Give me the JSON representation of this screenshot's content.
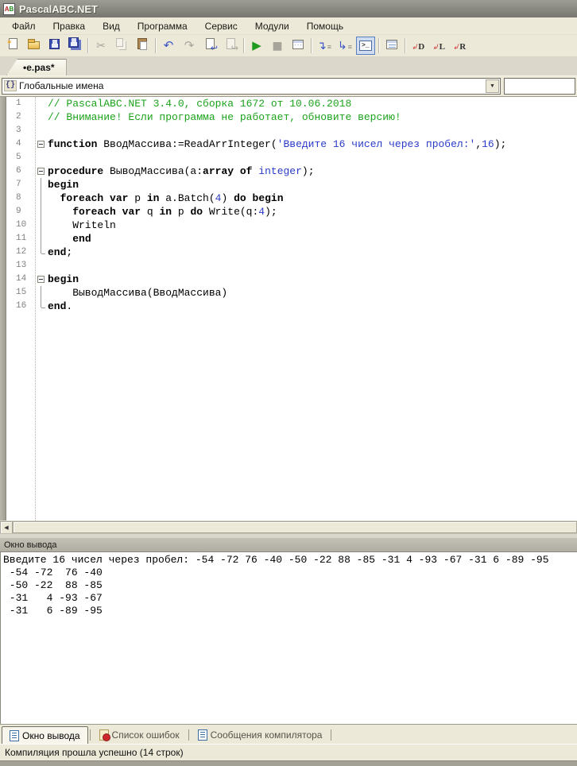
{
  "window": {
    "title": "PascalABC.NET"
  },
  "menu": {
    "items": [
      "Файл",
      "Правка",
      "Вид",
      "Программа",
      "Сервис",
      "Модули",
      "Помощь"
    ]
  },
  "toolbar": {
    "groups": [
      {
        "buttons": [
          {
            "icon": "new-file-icon",
            "enabled": true
          },
          {
            "icon": "open-file-icon",
            "enabled": true
          },
          {
            "icon": "save-icon",
            "enabled": true
          },
          {
            "icon": "save-all-icon",
            "enabled": true
          }
        ]
      },
      {
        "buttons": [
          {
            "icon": "cut-icon",
            "enabled": false
          },
          {
            "icon": "copy-icon",
            "enabled": false
          },
          {
            "icon": "paste-icon",
            "enabled": true
          }
        ]
      },
      {
        "buttons": [
          {
            "icon": "undo-icon",
            "enabled": true
          },
          {
            "icon": "redo-icon",
            "enabled": false
          },
          {
            "icon": "nav-back-icon",
            "enabled": true
          },
          {
            "icon": "nav-forward-icon",
            "enabled": false
          }
        ]
      },
      {
        "buttons": [
          {
            "icon": "run-icon",
            "enabled": true
          },
          {
            "icon": "stop-icon",
            "enabled": false
          },
          {
            "icon": "compile-window-icon",
            "enabled": true
          }
        ]
      },
      {
        "buttons": [
          {
            "icon": "step-over-icon",
            "enabled": true
          },
          {
            "icon": "step-into-icon",
            "enabled": true
          },
          {
            "icon": "show-console-icon",
            "enabled": true,
            "selected": true
          }
        ]
      },
      {
        "buttons": [
          {
            "icon": "format-code-icon",
            "enabled": true
          }
        ]
      },
      {
        "buttons": [
          {
            "icon": "dock-d-icon",
            "enabled": true,
            "label": "D"
          },
          {
            "icon": "dock-l-icon",
            "enabled": true,
            "label": "L"
          },
          {
            "icon": "dock-r-icon",
            "enabled": true,
            "label": "R"
          }
        ]
      }
    ]
  },
  "document_tab": {
    "label": "•e.pas*"
  },
  "navigation": {
    "scope_selector": {
      "icon_glyph": "{}",
      "value": "Глобальные имена"
    },
    "member_selector": {
      "value": ""
    }
  },
  "editor": {
    "lines": [
      {
        "n": "1",
        "fold": "",
        "segs": [
          {
            "c": "com",
            "t": "// PascalABC.NET 3.4.0, сборка 1672 от 10.06.2018"
          }
        ]
      },
      {
        "n": "2",
        "fold": "",
        "segs": [
          {
            "c": "com",
            "t": "// Внимание! Если программа не работает, обновите версию!"
          }
        ]
      },
      {
        "n": "3",
        "fold": "",
        "segs": []
      },
      {
        "n": "4",
        "fold": "collapse",
        "segs": [
          {
            "c": "kw",
            "t": "function"
          },
          {
            "c": "pl",
            "t": " ВводМассива:=ReadArrInteger("
          },
          {
            "c": "str",
            "t": "'Введите 16 чисел через пробел:'"
          },
          {
            "c": "pl",
            "t": ","
          },
          {
            "c": "num",
            "t": "16"
          },
          {
            "c": "pl",
            "t": ");"
          }
        ]
      },
      {
        "n": "5",
        "fold": "",
        "segs": []
      },
      {
        "n": "6",
        "fold": "collapse",
        "segs": [
          {
            "c": "kw",
            "t": "procedure"
          },
          {
            "c": "pl",
            "t": " ВыводМассива(a:"
          },
          {
            "c": "kw",
            "t": "array"
          },
          {
            "c": "pl",
            "t": " "
          },
          {
            "c": "kw",
            "t": "of"
          },
          {
            "c": "pl",
            "t": " "
          },
          {
            "c": "typ",
            "t": "integer"
          },
          {
            "c": "pl",
            "t": ");"
          }
        ]
      },
      {
        "n": "7",
        "fold": "line",
        "segs": [
          {
            "c": "kw",
            "t": "begin"
          }
        ]
      },
      {
        "n": "8",
        "fold": "line",
        "segs": [
          {
            "c": "pl",
            "t": "  "
          },
          {
            "c": "kw",
            "t": "foreach"
          },
          {
            "c": "pl",
            "t": " "
          },
          {
            "c": "kw",
            "t": "var"
          },
          {
            "c": "pl",
            "t": " p "
          },
          {
            "c": "kw",
            "t": "in"
          },
          {
            "c": "pl",
            "t": " a.Batch("
          },
          {
            "c": "num",
            "t": "4"
          },
          {
            "c": "pl",
            "t": ") "
          },
          {
            "c": "kw",
            "t": "do"
          },
          {
            "c": "pl",
            "t": " "
          },
          {
            "c": "kw",
            "t": "begin"
          }
        ]
      },
      {
        "n": "9",
        "fold": "line",
        "segs": [
          {
            "c": "pl",
            "t": "    "
          },
          {
            "c": "kw",
            "t": "foreach"
          },
          {
            "c": "pl",
            "t": " "
          },
          {
            "c": "kw",
            "t": "var"
          },
          {
            "c": "pl",
            "t": " q "
          },
          {
            "c": "kw",
            "t": "in"
          },
          {
            "c": "pl",
            "t": " p "
          },
          {
            "c": "kw",
            "t": "do"
          },
          {
            "c": "pl",
            "t": " Write(q:"
          },
          {
            "c": "num",
            "t": "4"
          },
          {
            "c": "pl",
            "t": ");"
          }
        ]
      },
      {
        "n": "10",
        "fold": "line",
        "segs": [
          {
            "c": "pl",
            "t": "    Writeln"
          }
        ]
      },
      {
        "n": "11",
        "fold": "line",
        "segs": [
          {
            "c": "pl",
            "t": "    "
          },
          {
            "c": "kw",
            "t": "end"
          }
        ]
      },
      {
        "n": "12",
        "fold": "end",
        "segs": [
          {
            "c": "kw",
            "t": "end"
          },
          {
            "c": "pl",
            "t": ";"
          }
        ]
      },
      {
        "n": "13",
        "fold": "",
        "segs": []
      },
      {
        "n": "14",
        "fold": "collapse",
        "segs": [
          {
            "c": "kw",
            "t": "begin"
          }
        ]
      },
      {
        "n": "15",
        "fold": "line",
        "segs": [
          {
            "c": "pl",
            "t": "    ВыводМассива(ВводМассива)"
          }
        ]
      },
      {
        "n": "16",
        "fold": "end",
        "segs": [
          {
            "c": "kw",
            "t": "end"
          },
          {
            "c": "pl",
            "t": "."
          }
        ]
      }
    ]
  },
  "output_panel": {
    "title": "Окно вывода",
    "lines": [
      "Введите 16 чисел через пробел: -54 -72 76 -40 -50 -22 88 -85 -31 4 -93 -67 -31 6 -89 -95",
      " -54 -72  76 -40",
      " -50 -22  88 -85",
      " -31   4 -93 -67",
      " -31   6 -89 -95"
    ]
  },
  "bottom_tabs": [
    {
      "label": "Окно вывода",
      "icon": "output-window-icon",
      "active": true
    },
    {
      "label": "Список ошибок",
      "icon": "error-list-icon",
      "active": false
    },
    {
      "label": "Сообщения компилятора",
      "icon": "compiler-messages-icon",
      "active": false
    }
  ],
  "status_bar": {
    "text": "Компиляция прошла успешно (14 строк)"
  },
  "colors": {
    "comment": "#1ca31c",
    "string": "#2b3bc8",
    "number": "#2b3bc8",
    "type": "#2b3bc8",
    "run_green": "#1f9c1f",
    "selection_blue": "#cfdcf0"
  }
}
